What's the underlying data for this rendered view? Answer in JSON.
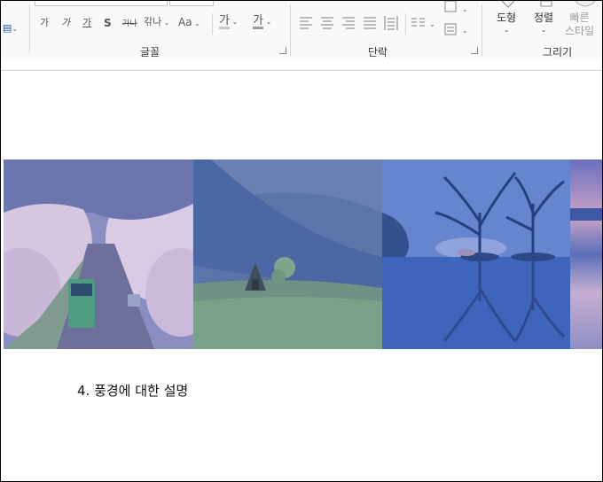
{
  "ribbon": {
    "font_group": {
      "label": "글꼴",
      "buttons": {
        "bold": "가",
        "italic": "가",
        "underline": "가",
        "shadow": "S",
        "strikethrough": "가나",
        "char_spacing": "갂나",
        "change_case": "Aa",
        "highlight": "가",
        "font_color": "가"
      }
    },
    "paragraph_group": {
      "label": "단락"
    },
    "drawing_group": {
      "label": "그리기",
      "shapes_label": "도형",
      "arrange_label": "정렬",
      "quick_styles_label": [
        "빠른",
        "스타일"
      ]
    }
  },
  "document": {
    "caption": "4. 풍경에 대한 설명",
    "banner_panels": [
      {
        "name": "cherry-blossom-road"
      },
      {
        "name": "green-hill-hut"
      },
      {
        "name": "lake-trees-reflection"
      },
      {
        "name": "sunset-sliver"
      }
    ]
  },
  "colors": {
    "ribbon_bg": "#f9f9f9",
    "overlay": "#3a5fb5"
  }
}
